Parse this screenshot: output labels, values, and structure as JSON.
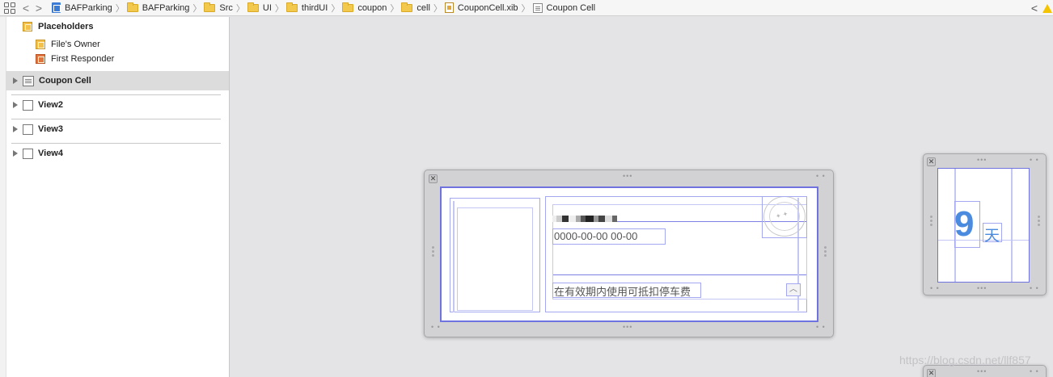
{
  "jumpbar": {
    "crumbs": [
      {
        "label": "BAFParking",
        "icon": "project-icon"
      },
      {
        "label": "BAFParking",
        "icon": "folder-icon"
      },
      {
        "label": "Src",
        "icon": "folder-icon"
      },
      {
        "label": "UI",
        "icon": "folder-icon"
      },
      {
        "label": "thirdUI",
        "icon": "folder-icon"
      },
      {
        "label": "coupon",
        "icon": "folder-icon"
      },
      {
        "label": "cell",
        "icon": "folder-icon"
      },
      {
        "label": "CouponCell.xib",
        "icon": "xib-icon"
      },
      {
        "label": "Coupon Cell",
        "icon": "cell-icon"
      }
    ],
    "back_glyph": "<",
    "forward_glyph": ">",
    "related_glyph": "<"
  },
  "outline": {
    "placeholders_title": "Placeholders",
    "files_owner": "File's Owner",
    "first_responder": "First Responder",
    "items": [
      {
        "label": "Coupon Cell",
        "icon": "table-cell-icon",
        "selected": true
      },
      {
        "label": "View2",
        "icon": "view-icon",
        "selected": false
      },
      {
        "label": "View3",
        "icon": "view-icon",
        "selected": false
      },
      {
        "label": "View4",
        "icon": "view-icon",
        "selected": false
      }
    ]
  },
  "canvas": {
    "coupon_cell": {
      "date_text": "0000-00-00 00-00",
      "desc_text": "在有效期内使用可抵扣停车费"
    },
    "view2": {
      "day_number": "9",
      "day_unit": "天"
    }
  },
  "watermark": "https://blog.csdn.net/llf857",
  "colors": {
    "selection": "#6f73e0",
    "constraint_box": "#a4a8f0",
    "warning": "#f5c400",
    "day_number": "#4a8be0"
  }
}
